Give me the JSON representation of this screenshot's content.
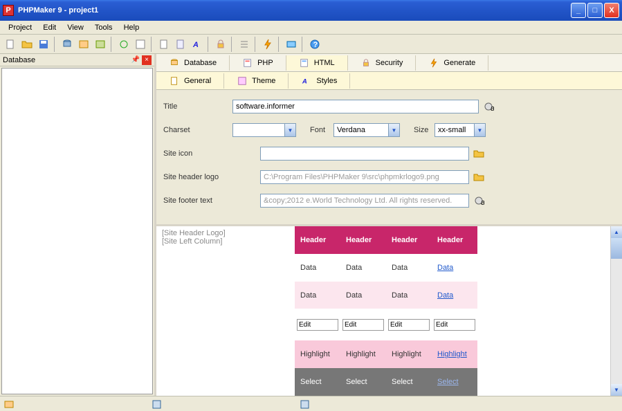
{
  "window": {
    "title": "PHPMaker 9 - project1",
    "app_icon_letter": "P"
  },
  "menu": {
    "items": [
      "Project",
      "Edit",
      "View",
      "Tools",
      "Help"
    ]
  },
  "sidebar": {
    "title": "Database"
  },
  "main_tabs": [
    {
      "label": "Database",
      "icon": "db-icon"
    },
    {
      "label": "PHP",
      "icon": "php-icon"
    },
    {
      "label": "HTML",
      "icon": "html-icon"
    },
    {
      "label": "Security",
      "icon": "lock-icon"
    },
    {
      "label": "Generate",
      "icon": "bolt-icon"
    }
  ],
  "sub_tabs": [
    {
      "label": "General",
      "icon": "doc-icon"
    },
    {
      "label": "Theme",
      "icon": "theme-icon"
    },
    {
      "label": "Styles",
      "icon": "style-icon"
    }
  ],
  "form": {
    "title_label": "Title",
    "title_value": "software.informer",
    "charset_label": "Charset",
    "charset_value": "",
    "font_label": "Font",
    "font_value": "Verdana",
    "size_label": "Size",
    "size_value": "xx-small",
    "siteicon_label": "Site icon",
    "siteicon_value": "",
    "headerlogo_label": "Site header logo",
    "headerlogo_value": "C:\\Program Files\\PHPMaker 9\\src\\phpmkrlogo9.png",
    "footertext_label": "Site footer text",
    "footertext_value": "&copy;2012 e.World Technology Ltd. All rights reserved."
  },
  "preview": {
    "left_lines": [
      "[Site Header Logo]",
      "[Site Left Column]"
    ],
    "headers": [
      "Header",
      "Header",
      "Header",
      "Header"
    ],
    "rows": [
      {
        "class": "d1",
        "cells": [
          "Data",
          "Data",
          "Data"
        ],
        "link": "Data"
      },
      {
        "class": "d2",
        "cells": [
          "Data",
          "Data",
          "Data"
        ],
        "link": "Data"
      },
      {
        "class": "ed",
        "cells": [
          "Edit",
          "Edit",
          "Edit",
          "Edit"
        ]
      },
      {
        "class": "hl",
        "cells": [
          "Highlight",
          "Highlight",
          "Highlight"
        ],
        "link": "Highlight"
      },
      {
        "class": "sel",
        "cells": [
          "Select",
          "Select",
          "Select"
        ],
        "link": "Select"
      }
    ]
  }
}
